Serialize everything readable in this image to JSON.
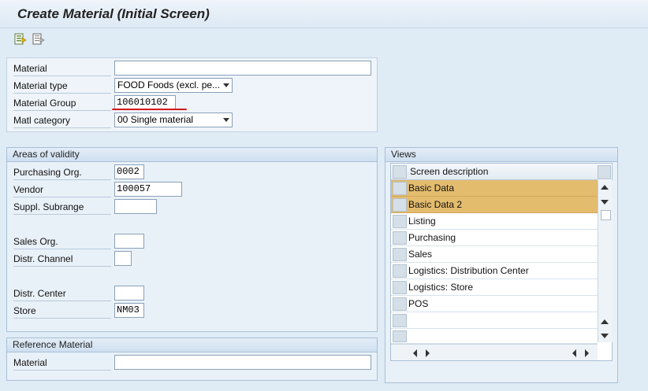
{
  "title": "Create Material (Initial Screen)",
  "toolbar": {
    "icons": [
      "data-entry-icon",
      "org-levels-icon"
    ]
  },
  "header_fields": {
    "material_label": "Material",
    "material_value": "",
    "material_type_label": "Material type",
    "material_type_value": "FOOD Foods (excl. pe...",
    "material_group_label": "Material Group",
    "material_group_value": "106010102",
    "matl_category_label": "Matl category",
    "matl_category_value": "00 Single material"
  },
  "areas": {
    "heading": "Areas of validity",
    "purchasing_org_label": "Purchasing Org.",
    "purchasing_org_value": "0002",
    "vendor_label": "Vendor",
    "vendor_value": "100057",
    "suppl_subrange_label": "Suppl. Subrange",
    "suppl_subrange_value": "",
    "sales_org_label": "Sales Org.",
    "sales_org_value": "",
    "distr_channel_label": "Distr. Channel",
    "distr_channel_value": "",
    "distr_center_label": "Distr. Center",
    "distr_center_value": "",
    "store_label": "Store",
    "store_value": "NM03"
  },
  "reference": {
    "heading": "Reference Material",
    "material_label": "Material",
    "material_value": ""
  },
  "views": {
    "heading": "Views",
    "column_header": "Screen description",
    "rows": [
      {
        "label": "Basic Data",
        "selected": true
      },
      {
        "label": "Basic Data 2",
        "selected": true
      },
      {
        "label": "Listing",
        "selected": false
      },
      {
        "label": "Purchasing",
        "selected": false
      },
      {
        "label": "Sales",
        "selected": false
      },
      {
        "label": "Logistics: Distribution Center",
        "selected": false
      },
      {
        "label": "Logistics: Store",
        "selected": false
      },
      {
        "label": "POS",
        "selected": false
      },
      {
        "label": "",
        "selected": false
      }
    ],
    "highlight_color": "#e3bc6e"
  },
  "colors": {
    "background": "#dfebf5",
    "panel": "#e9f1f8",
    "accent_underline": "#d21919"
  }
}
